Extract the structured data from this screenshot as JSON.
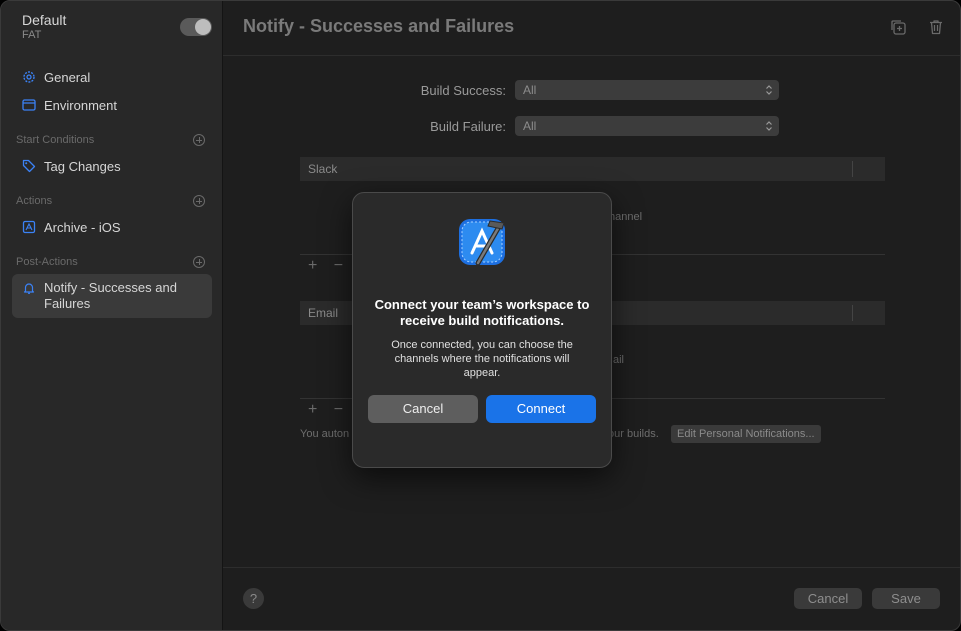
{
  "workflow": {
    "name": "Default",
    "subtitle": "FAT",
    "enabled": true
  },
  "sidebar": {
    "general": "General",
    "environment": "Environment",
    "start_conditions": {
      "header": "Start Conditions",
      "items": [
        "Tag Changes"
      ]
    },
    "actions": {
      "header": "Actions",
      "items": [
        "Archive - iOS"
      ]
    },
    "post_actions": {
      "header": "Post-Actions",
      "items": [
        "Notify - Successes and Failures"
      ]
    }
  },
  "main": {
    "title": "Notify - Successes and Failures",
    "build_success_label": "Build Success:",
    "build_success_value": "All",
    "build_failure_label": "Build Failure:",
    "build_failure_value": "All",
    "slack_header": "Slack",
    "slack_hint_fragment": "hannel",
    "email_header": "Email",
    "email_hint_fragment": "ail",
    "auto_note_left": "You auton",
    "auto_note_right": "our builds.",
    "edit_personal": "Edit Personal Notifications...",
    "add_remove": "+ −"
  },
  "footer": {
    "help": "?",
    "cancel": "Cancel",
    "save": "Save"
  },
  "dialog": {
    "title": "Connect your team’s workspace to receive build notifications.",
    "body": "Once connected, you can choose the channels where the notifications will appear.",
    "cancel": "Cancel",
    "connect": "Connect",
    "icon": "xcode-icon"
  },
  "colors": {
    "accent": "#1a73e8",
    "sidebar_icon": "#3b82f6"
  }
}
